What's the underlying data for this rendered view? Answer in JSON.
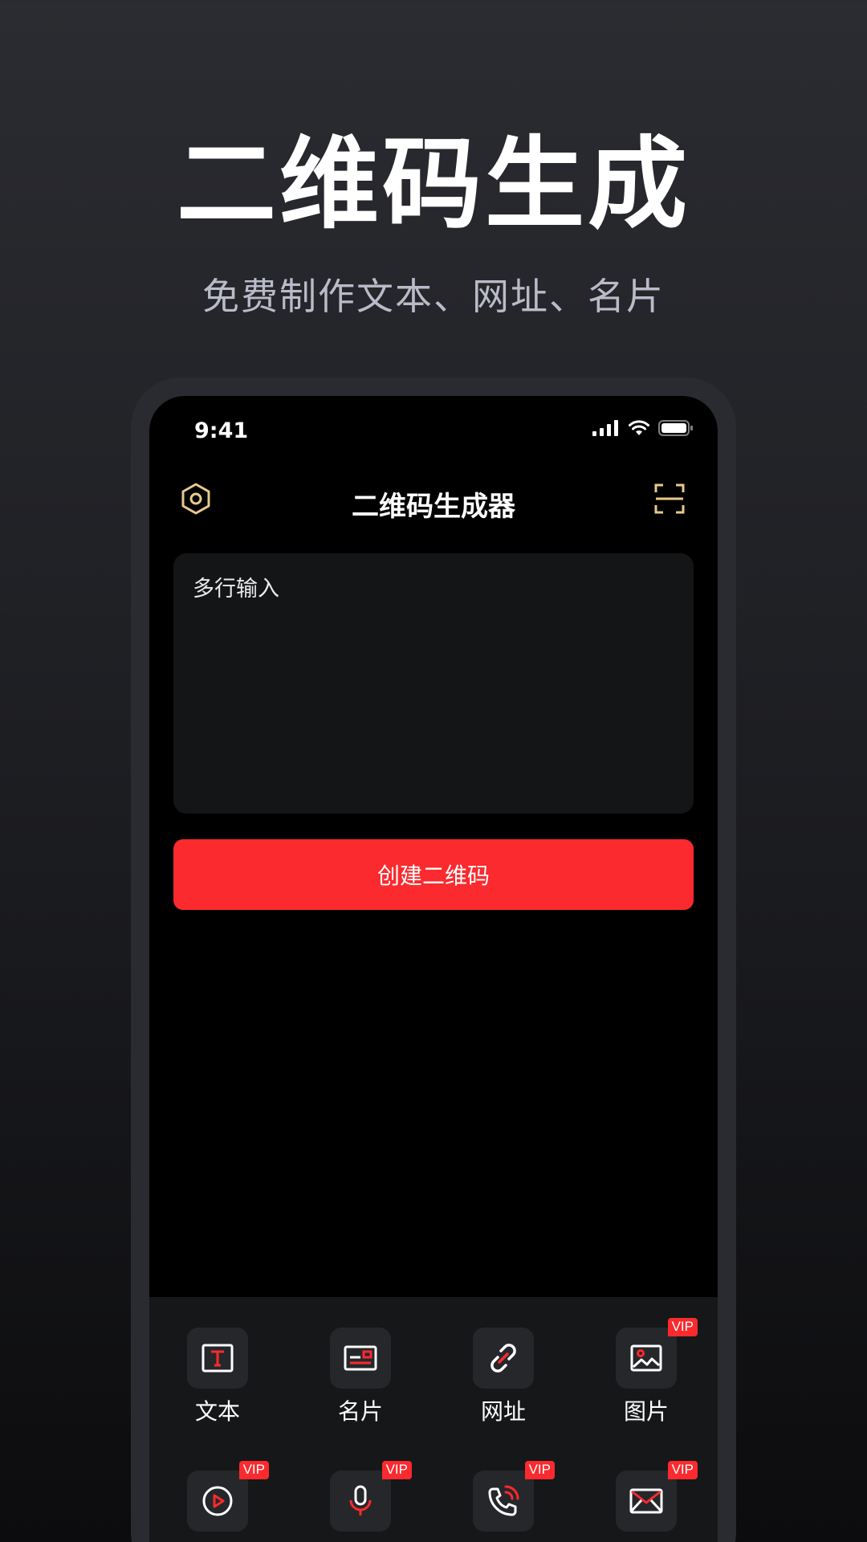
{
  "hero": {
    "title": "二维码生成",
    "subtitle": "免费制作文本、网址、名片"
  },
  "status_bar": {
    "time": "9:41"
  },
  "nav": {
    "title": "二维码生成器",
    "left_icon": "settings-hexagon-icon",
    "right_icon": "scan-icon"
  },
  "input": {
    "placeholder": "多行输入",
    "value": ""
  },
  "create_button": {
    "label": "创建二维码"
  },
  "tools": [
    {
      "label": "文本",
      "icon": "text-icon",
      "vip": false
    },
    {
      "label": "名片",
      "icon": "card-icon",
      "vip": false
    },
    {
      "label": "网址",
      "icon": "link-icon",
      "vip": false
    },
    {
      "label": "图片",
      "icon": "image-icon",
      "vip": true
    },
    {
      "label": "",
      "icon": "video-play-icon",
      "vip": true
    },
    {
      "label": "",
      "icon": "microphone-icon",
      "vip": true
    },
    {
      "label": "",
      "icon": "phone-call-icon",
      "vip": true
    },
    {
      "label": "",
      "icon": "mail-icon",
      "vip": true
    }
  ],
  "vip_label": "VIP",
  "colors": {
    "accent": "#fa2a2e",
    "gold": "#e8c98c",
    "background": "#000000"
  }
}
